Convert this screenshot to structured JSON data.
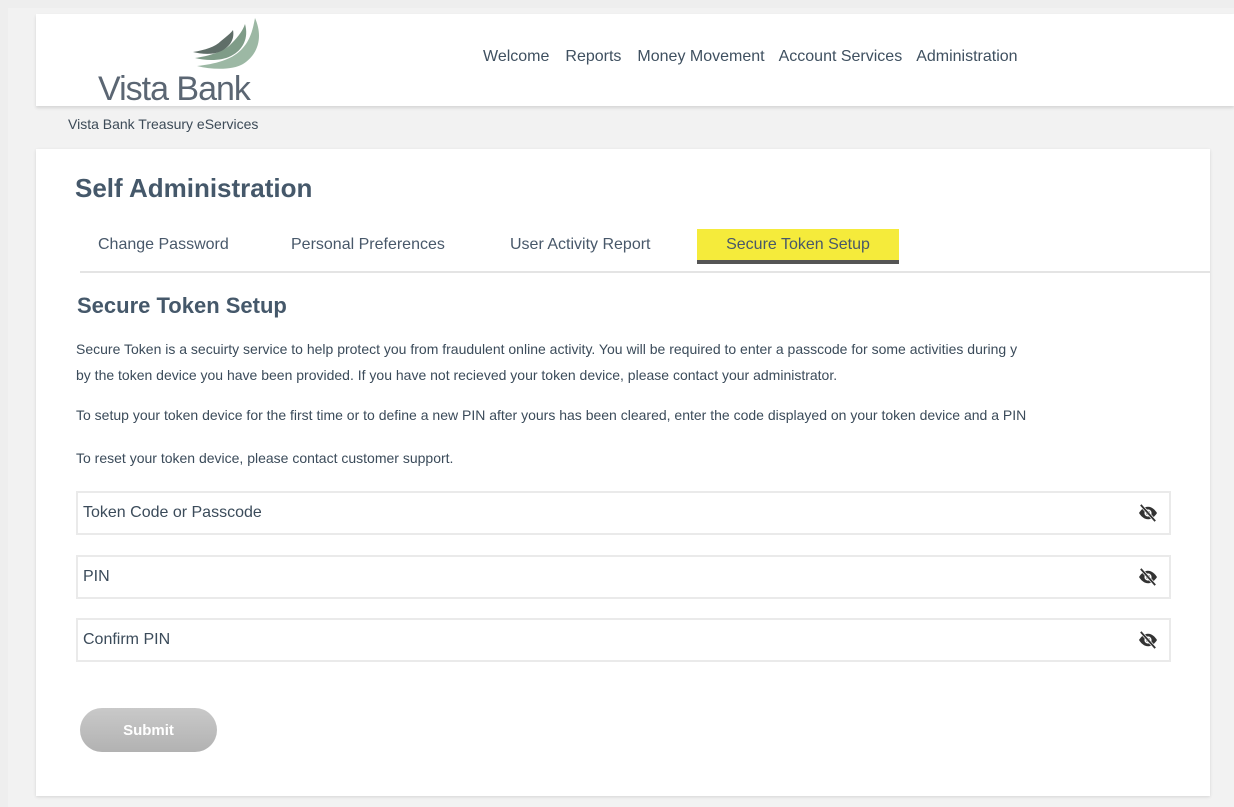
{
  "brand": {
    "name": "Vista Bank",
    "subtitle": "Vista Bank Treasury eServices",
    "accent_color": "#f5eb3b",
    "wing_color": "#8fae9c"
  },
  "nav": {
    "items": [
      "Welcome",
      "Reports",
      "Money Movement",
      "Account Services",
      "Administration"
    ]
  },
  "page": {
    "title": "Self Administration"
  },
  "tabs": [
    {
      "label": "Change Password"
    },
    {
      "label": "Personal Preferences"
    },
    {
      "label": "User Activity Report"
    },
    {
      "label": "Secure Token Setup",
      "active": true
    }
  ],
  "section": {
    "title": "Secure Token Setup",
    "para1_line1": "Secure Token is a secuirty service to help protect you from fraudulent online activity. You will be required to enter a passcode for some activities during y",
    "para1_line2": "by the token device you have been provided. If you have not recieved your token device, please contact your administrator.",
    "para2": "To setup your token device for the first time or to define a new PIN after yours has been cleared, enter the code displayed on your token device and a PIN",
    "para3": "To reset your token device, please contact customer support."
  },
  "form": {
    "token_placeholder": "Token Code or Passcode",
    "pin_placeholder": "PIN",
    "confirm_pin_placeholder": "Confirm PIN",
    "token_value": "",
    "pin_value": "",
    "confirm_pin_value": "",
    "visibility_icon": "eye-slash-icon",
    "submit_label": "Submit"
  }
}
